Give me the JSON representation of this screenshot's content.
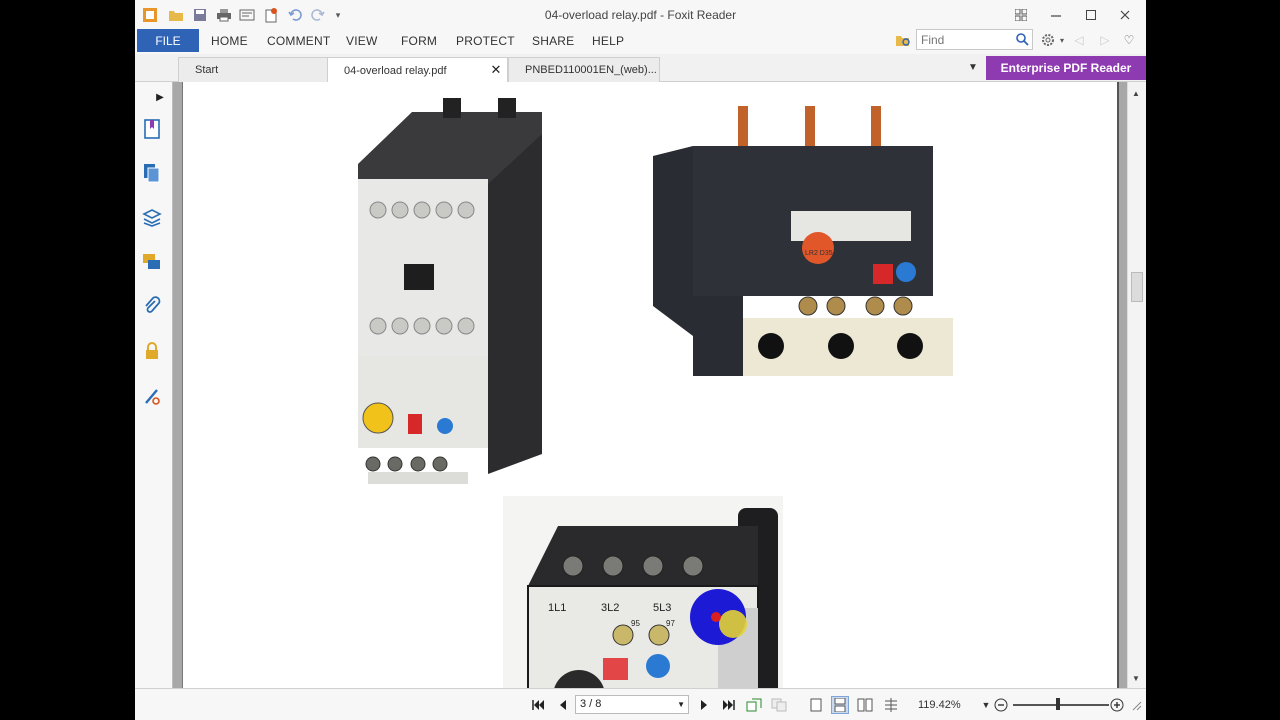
{
  "window": {
    "title": "04-overload relay.pdf - Foxit Reader"
  },
  "menu": {
    "file": "FILE",
    "items": [
      "HOME",
      "COMMENT",
      "VIEW",
      "FORM",
      "PROTECT",
      "SHARE",
      "HELP"
    ]
  },
  "search": {
    "placeholder": "Find"
  },
  "tabs": [
    {
      "label": "Start"
    },
    {
      "label": "04-overload relay.pdf"
    },
    {
      "label": "PNBED110001EN_(web)..."
    }
  ],
  "enterprise_button": "Enterprise PDF Reader",
  "status": {
    "page": "3 / 8",
    "zoom": "119.42%"
  },
  "colors": {
    "file_button": "#2f63b6",
    "enterprise_button": "#8e3ab0",
    "sidebar_icon": "#2a6db5"
  },
  "relay_labels": {
    "terminal_1": "1L1",
    "terminal_2": "3L2",
    "terminal_3": "5L3",
    "contact_nc": "95",
    "contact_no": "97",
    "brand_label": "LR2 D35"
  }
}
